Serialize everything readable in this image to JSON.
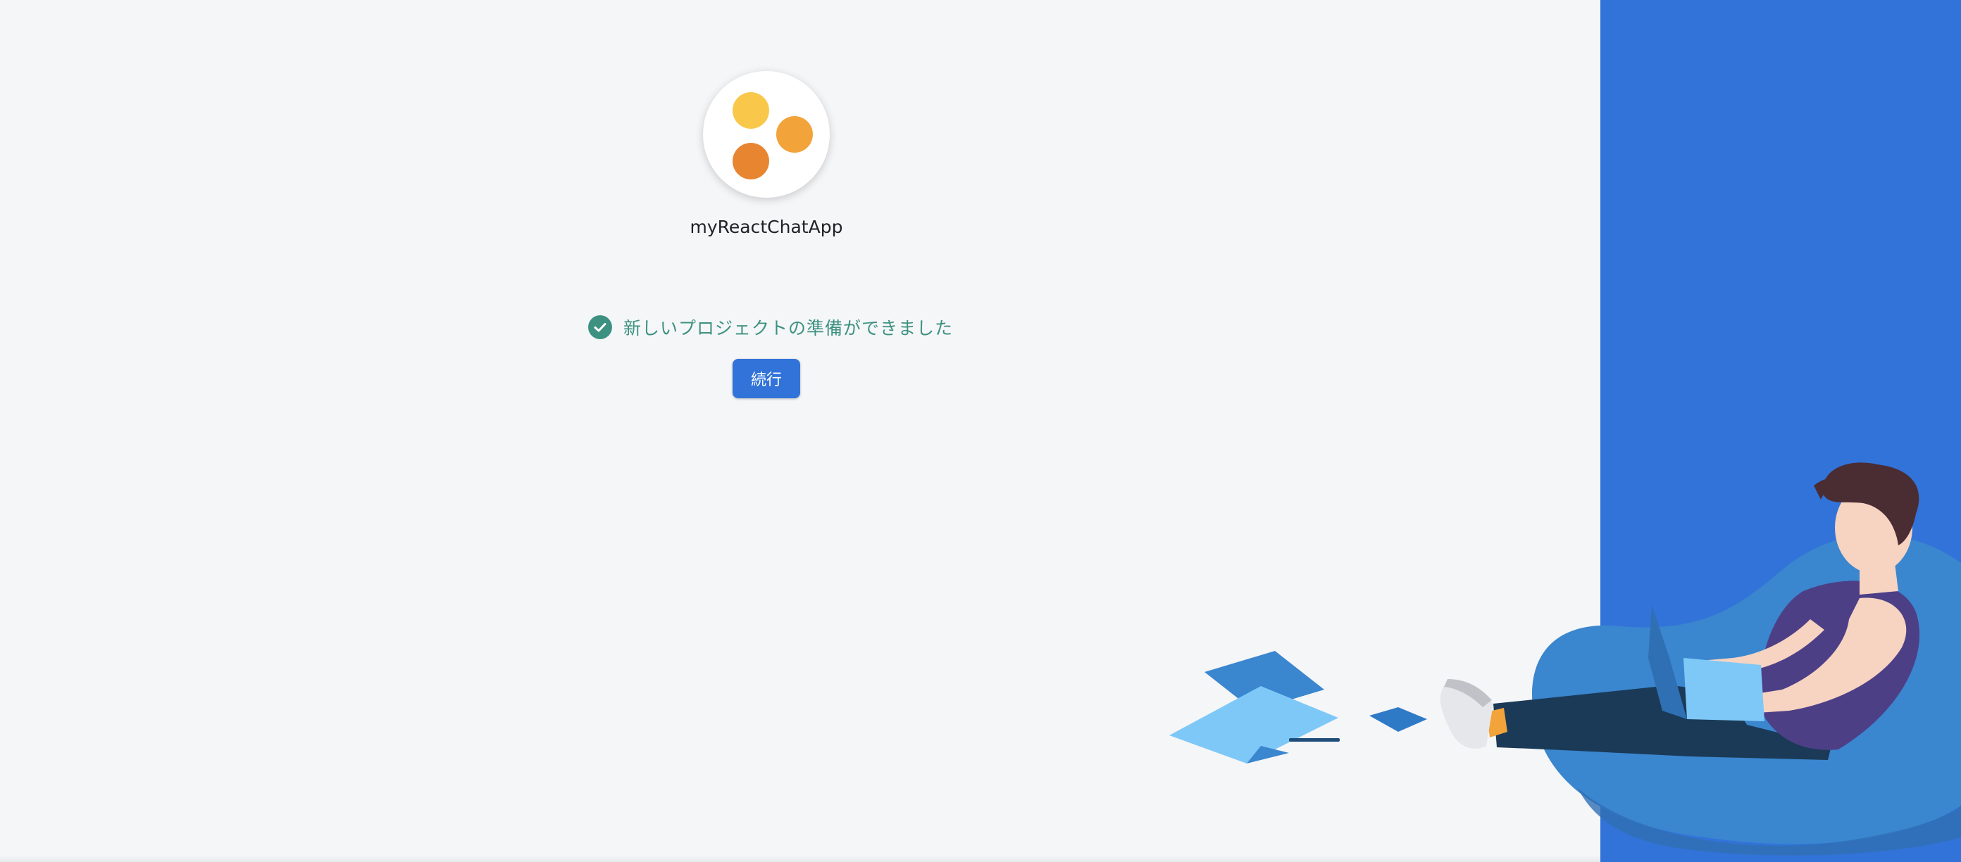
{
  "project": {
    "name": "myReactChatApp"
  },
  "status": {
    "message": "新しいプロジェクトの準備ができました"
  },
  "actions": {
    "continue_label": "続行"
  },
  "colors": {
    "accent": "#3273d9",
    "success": "#3d9181",
    "logo_dot_1": "#f9c84a",
    "logo_dot_2": "#f2a33a",
    "logo_dot_3": "#e88531"
  },
  "icons": {
    "logo": "three-dots-logo-icon",
    "status": "check-circle-icon"
  }
}
